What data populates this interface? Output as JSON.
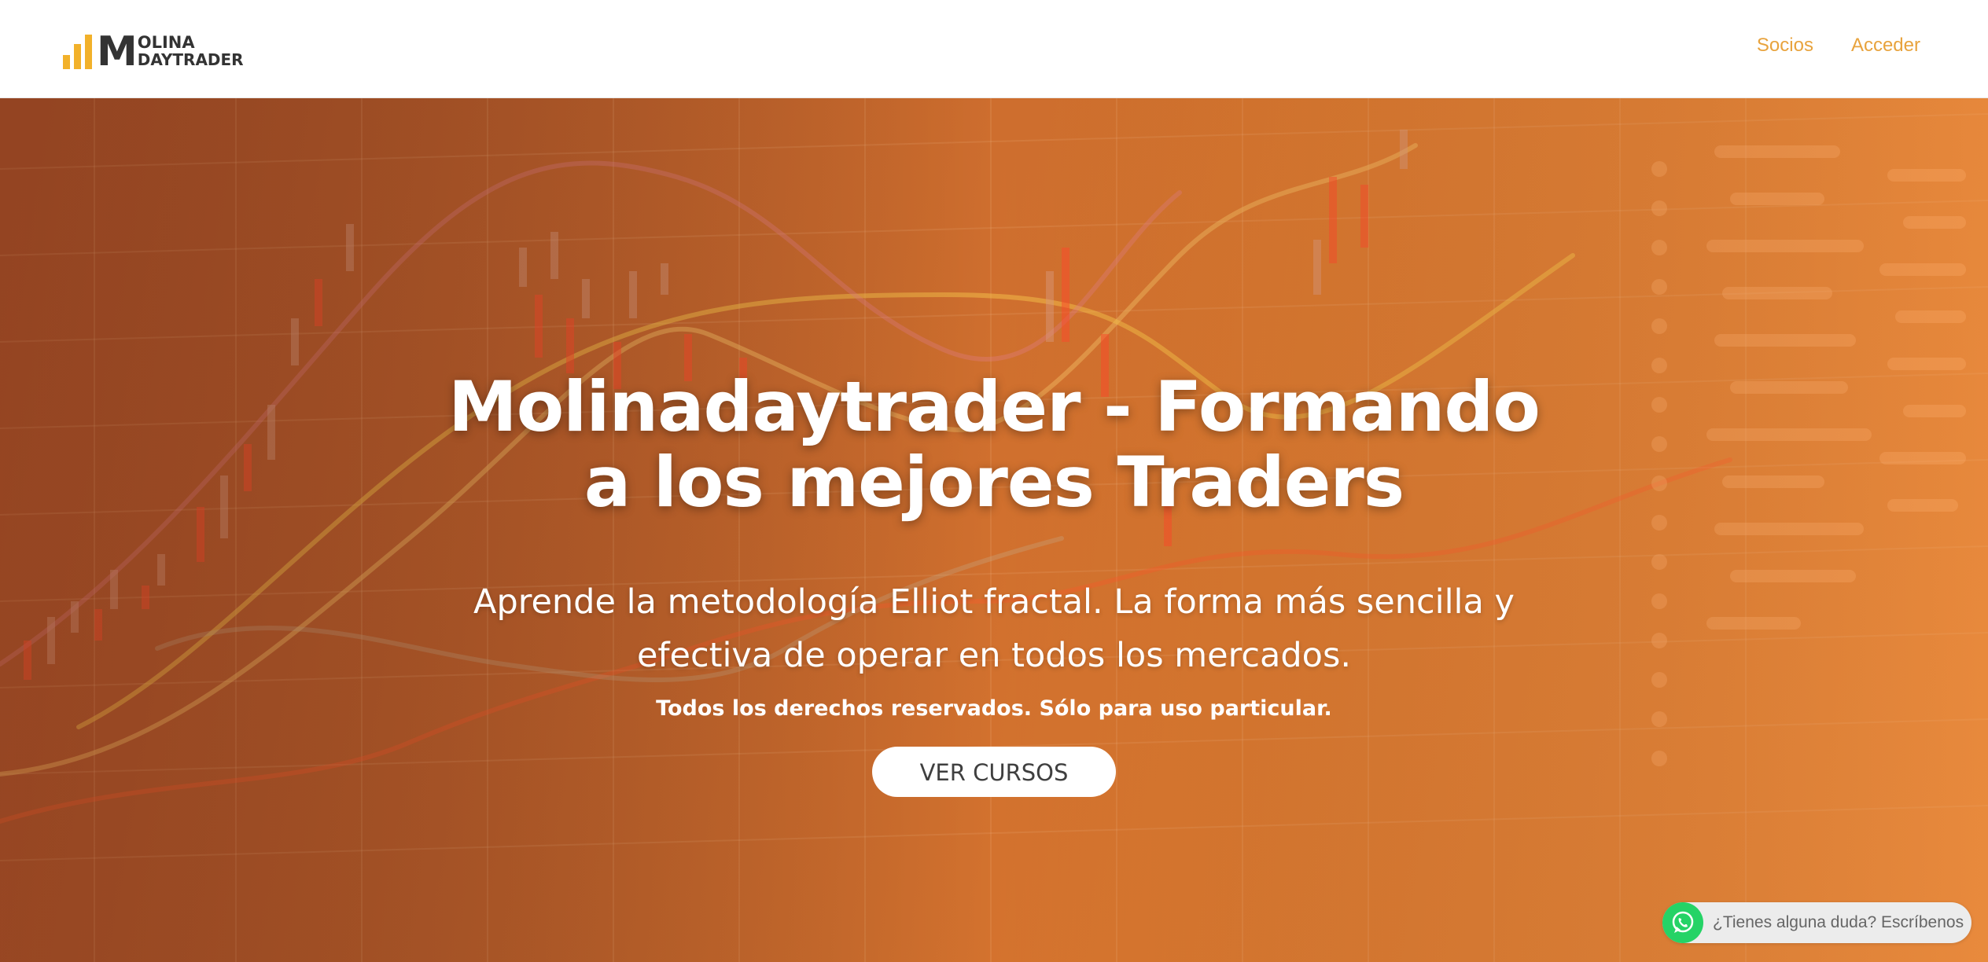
{
  "header": {
    "logo": {
      "letter": "M",
      "line1": "OLINA",
      "line2": "DAYTRADER",
      "bar_color": "#f2b12a",
      "text_color": "#333333"
    },
    "nav": {
      "items": [
        {
          "label": "Socios"
        },
        {
          "label": "Acceder"
        }
      ],
      "color": "#e8a33d"
    }
  },
  "hero": {
    "title": "Molinadaytrader - Formando a los mejores Traders",
    "subtitle": "Aprende la metodología Elliot fractal. La forma más sencilla y efectiva de operar en todos los mercados.",
    "rights": "Todos los derechos reservados. Sólo para uso particular.",
    "cta_label": "VER CURSOS",
    "background_colors": [
      "#a84f28",
      "#d9772f",
      "#e6863a"
    ]
  },
  "whatsapp": {
    "text": "¿Tienes alguna duda? Escríbenos",
    "icon": "whatsapp-icon",
    "color": "#25d366"
  }
}
